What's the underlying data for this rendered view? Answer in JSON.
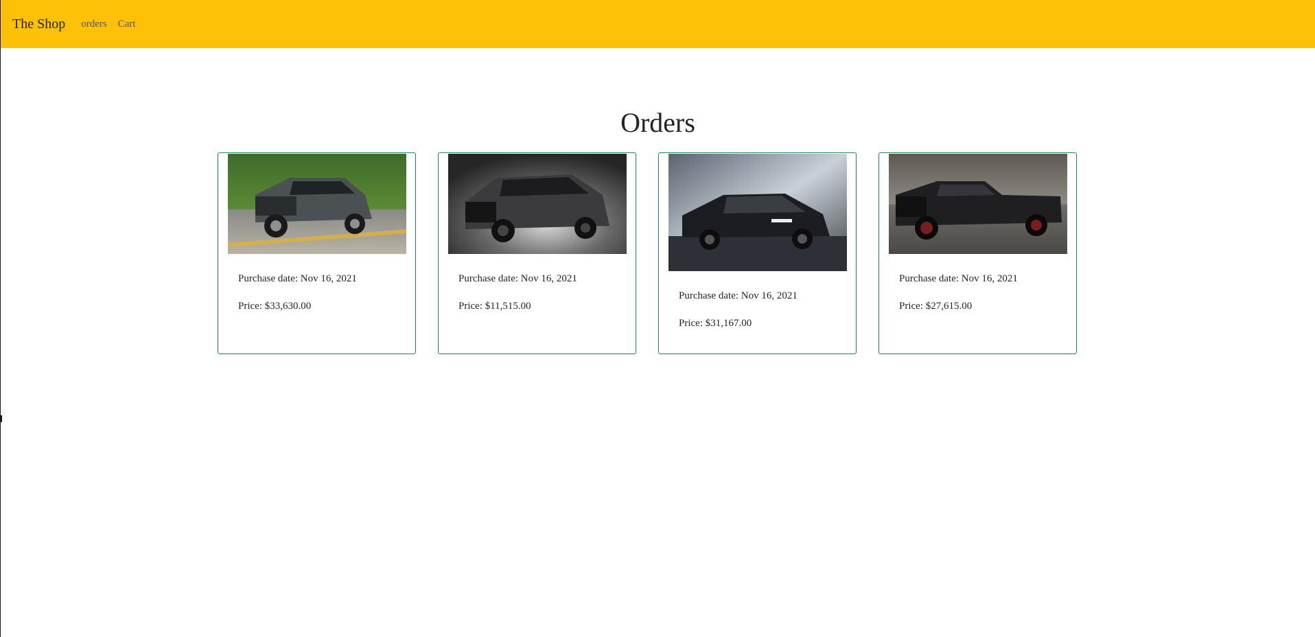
{
  "navbar": {
    "brand": "The Shop",
    "links": [
      "orders",
      "Cart"
    ],
    "background": "#ffc107"
  },
  "page_title": "Orders",
  "orders": [
    {
      "image_icon": "pickup-truck-photo",
      "date_label": "Purchase date: Nov 16, 2021",
      "price_label": "Price: $33,630.00"
    },
    {
      "image_icon": "suv-photo",
      "date_label": "Purchase date: Nov 16, 2021",
      "price_label": "Price: $11,515.00"
    },
    {
      "image_icon": "sedan-photo",
      "date_label": "Purchase date: Nov 16, 2021",
      "price_label": "Price: $31,167.00"
    },
    {
      "image_icon": "pickup-truck-photo",
      "date_label": "Purchase date: Nov 16, 2021",
      "price_label": "Price: $27,615.00"
    }
  ],
  "colors": {
    "card_border": "#198754",
    "accent": "#ffc107"
  }
}
